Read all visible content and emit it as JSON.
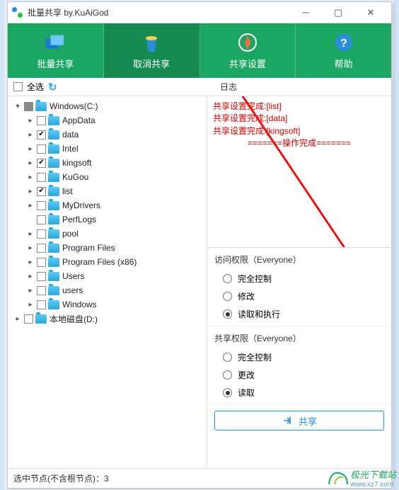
{
  "titlebar": {
    "title": "批量共享 by.KuAiGod"
  },
  "toolbar": {
    "items": [
      {
        "label": "批量共享",
        "icon": "folders"
      },
      {
        "label": "取消共享",
        "icon": "trash",
        "active": true
      },
      {
        "label": "共享设置",
        "icon": "compass"
      },
      {
        "label": "帮助",
        "icon": "help"
      }
    ]
  },
  "subbar": {
    "select_all": "全选",
    "log_label": "日志"
  },
  "tree": [
    {
      "indent": 0,
      "expander": "▾",
      "state": "partial",
      "label": "Windows(C:)"
    },
    {
      "indent": 1,
      "expander": "▸",
      "state": "",
      "label": "AppData"
    },
    {
      "indent": 1,
      "expander": "▸",
      "state": "checked",
      "label": "data"
    },
    {
      "indent": 1,
      "expander": "▸",
      "state": "",
      "label": "Intel"
    },
    {
      "indent": 1,
      "expander": "▸",
      "state": "checked",
      "label": "kingsoft"
    },
    {
      "indent": 1,
      "expander": "▸",
      "state": "",
      "label": "KuGou"
    },
    {
      "indent": 1,
      "expander": "▸",
      "state": "checked",
      "label": "list"
    },
    {
      "indent": 1,
      "expander": "▸",
      "state": "",
      "label": "MyDrivers"
    },
    {
      "indent": 1,
      "expander": "",
      "state": "",
      "label": "PerfLogs"
    },
    {
      "indent": 1,
      "expander": "▸",
      "state": "",
      "label": "pool"
    },
    {
      "indent": 1,
      "expander": "▸",
      "state": "",
      "label": "Program Files"
    },
    {
      "indent": 1,
      "expander": "▸",
      "state": "",
      "label": "Program Files (x86)"
    },
    {
      "indent": 1,
      "expander": "▸",
      "state": "",
      "label": "Users"
    },
    {
      "indent": 1,
      "expander": "▸",
      "state": "",
      "label": "users"
    },
    {
      "indent": 1,
      "expander": "▸",
      "state": "",
      "label": "Windows"
    },
    {
      "indent": 0,
      "expander": "▸",
      "state": "",
      "label": "本地磁盘(D:)"
    }
  ],
  "log": {
    "lines": [
      {
        "prefix": "共享设置完成:",
        "value": "[list]"
      },
      {
        "prefix": "共享设置完成:",
        "value": "[data]"
      },
      {
        "prefix": "共享设置完成:",
        "value": "[kingsoft]"
      }
    ],
    "done": "=======操作完成======="
  },
  "access_perm": {
    "title": "访问权限（Everyone）",
    "options": [
      "完全控制",
      "修改",
      "读取和执行"
    ],
    "selected": 2
  },
  "share_perm": {
    "title": "共享权限（Everyone）",
    "options": [
      "完全控制",
      "更改",
      "读取"
    ],
    "selected": 2
  },
  "share_button": "共享",
  "status": {
    "label": "选中节点(不含根节点)：",
    "count": "3"
  },
  "watermark": {
    "text": "极光下载站",
    "url": "www.xz7.com"
  }
}
